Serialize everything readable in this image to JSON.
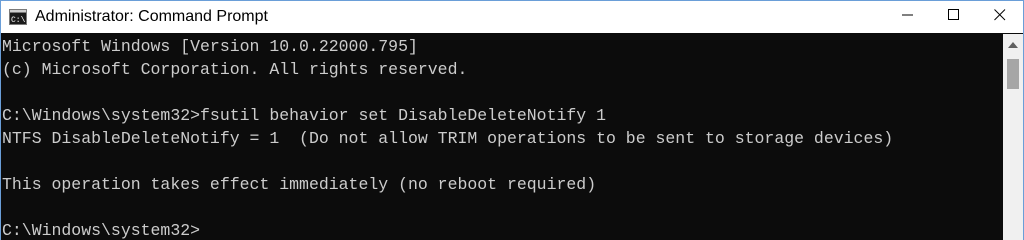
{
  "window": {
    "title": "Administrator: Command Prompt",
    "icon": "cmd-icon"
  },
  "controls": {
    "minimize_icon": "minimize-icon",
    "maximize_icon": "maximize-icon",
    "close_icon": "close-icon"
  },
  "console": {
    "lines": [
      "Microsoft Windows [Version 10.0.22000.795]",
      "(c) Microsoft Corporation. All rights reserved.",
      "",
      "C:\\Windows\\system32>fsutil behavior set DisableDeleteNotify 1",
      "NTFS DisableDeleteNotify = 1  (Do not allow TRIM operations to be sent to storage devices)",
      "",
      "This operation takes effect immediately (no reboot required)",
      "",
      "C:\\Windows\\system32>"
    ]
  },
  "colors": {
    "console_bg": "#0c0c0c",
    "console_text": "#cccccc",
    "titlebar_bg": "#ffffff"
  }
}
